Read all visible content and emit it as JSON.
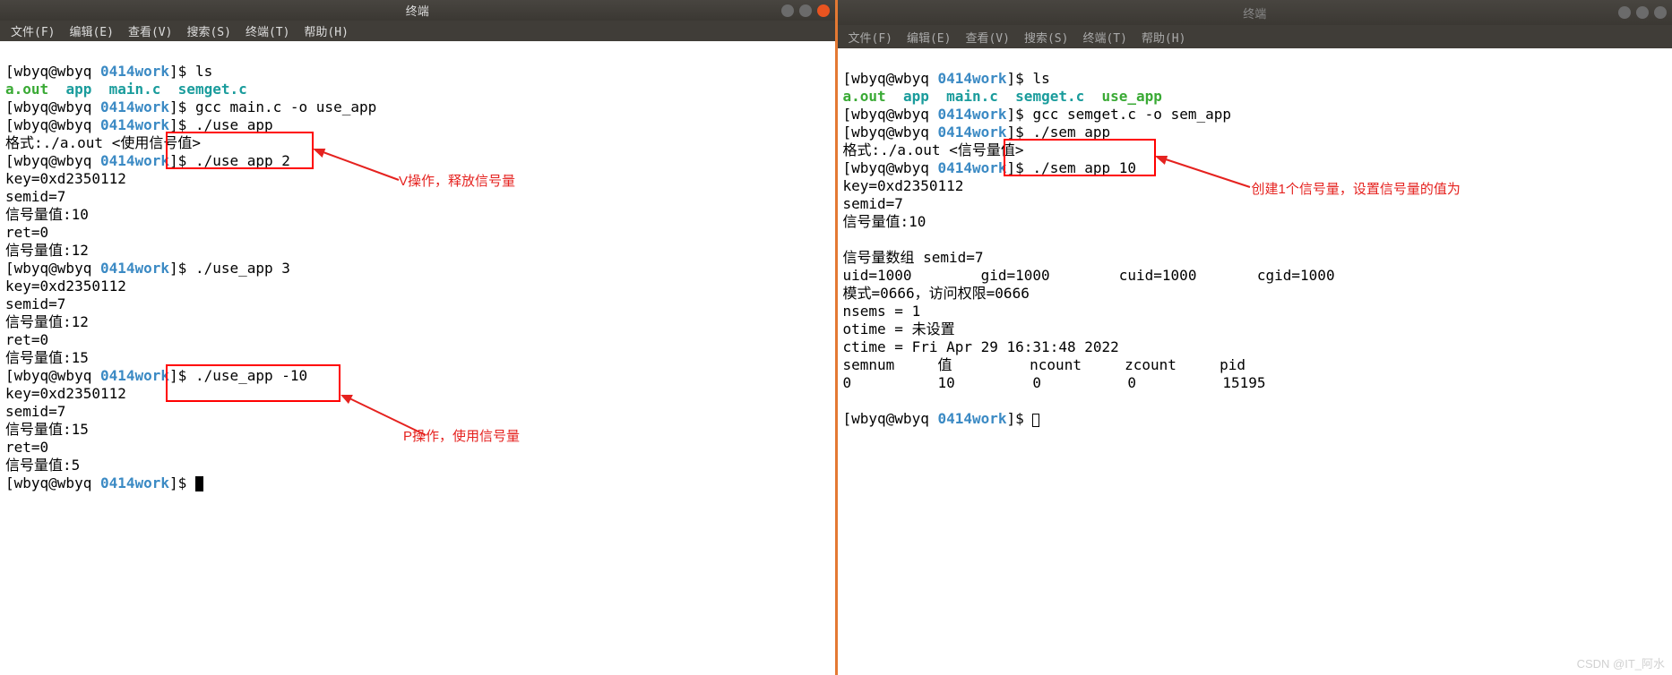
{
  "left": {
    "title": "终端",
    "menu": [
      "文件(F)",
      "编辑(E)",
      "查看(V)",
      "搜索(S)",
      "终端(T)",
      "帮助(H)"
    ],
    "prompt_user": "[wbyq@wbyq ",
    "prompt_dir": "0414work",
    "prompt_end": "]$ ",
    "cmd_ls": "ls",
    "ls_out": {
      "a": "a.out",
      "b": "app",
      "c": "main.c",
      "d": "semget.c"
    },
    "cmd2": "gcc main.c -o use_app",
    "cmd3": "./use_app",
    "line_usage": "格式:./a.out <使用信号值>",
    "cmd4": "./use_app 2",
    "out_a1": "key=0xd2350112",
    "out_a2": "semid=7",
    "out_a3": "信号量值:10",
    "out_a4": "ret=0",
    "out_a5": "信号量值:12",
    "cmd5": "./use_app 3",
    "out_b1": "key=0xd2350112",
    "out_b2": "semid=7",
    "out_b3": "信号量值:12",
    "out_b4": "ret=0",
    "out_b5": "信号量值:15",
    "cmd6": "./use_app -10",
    "out_c1": "key=0xd2350112",
    "out_c2": "semid=7",
    "out_c3": "信号量值:15",
    "out_c4": "ret=0",
    "out_c5": "信号量值:5",
    "annot1": "V操作，释放信号量",
    "annot2": "P操作，使用信号量"
  },
  "right": {
    "title": "终端",
    "menu": [
      "文件(F)",
      "编辑(E)",
      "查看(V)",
      "搜索(S)",
      "终端(T)",
      "帮助(H)"
    ],
    "prompt_user": "[wbyq@wbyq ",
    "prompt_dir": "0414work",
    "prompt_end": "]$ ",
    "cmd_ls": "ls",
    "ls_out": {
      "a": "a.out",
      "b": "app",
      "c": "main.c",
      "d": "semget.c",
      "e": "use_app"
    },
    "cmd2": "gcc semget.c -o sem_app",
    "cmd3": "./sem_app",
    "line_usage": "格式:./a.out <信号量值>",
    "cmd4": "./sem_app 10",
    "out_a1": "key=0xd2350112",
    "out_a2": "semid=7",
    "out_a3": "信号量值:10",
    "blank": "",
    "out_b1": "信号量数组 semid=7",
    "out_b2": "uid=1000        gid=1000        cuid=1000       cgid=1000",
    "out_b3": "模式=0666，访问权限=0666",
    "out_b4": "nsems = 1",
    "out_b5": "otime = 未设置",
    "out_b6": "ctime = Fri Apr 29 16:31:48 2022",
    "out_b7": "semnum     值         ncount     zcount     pid",
    "out_b8": "0          10         0          0          15195",
    "annot1": "创建1个信号量，设置信号量的值为"
  },
  "watermark": "CSDN @IT_阿水"
}
